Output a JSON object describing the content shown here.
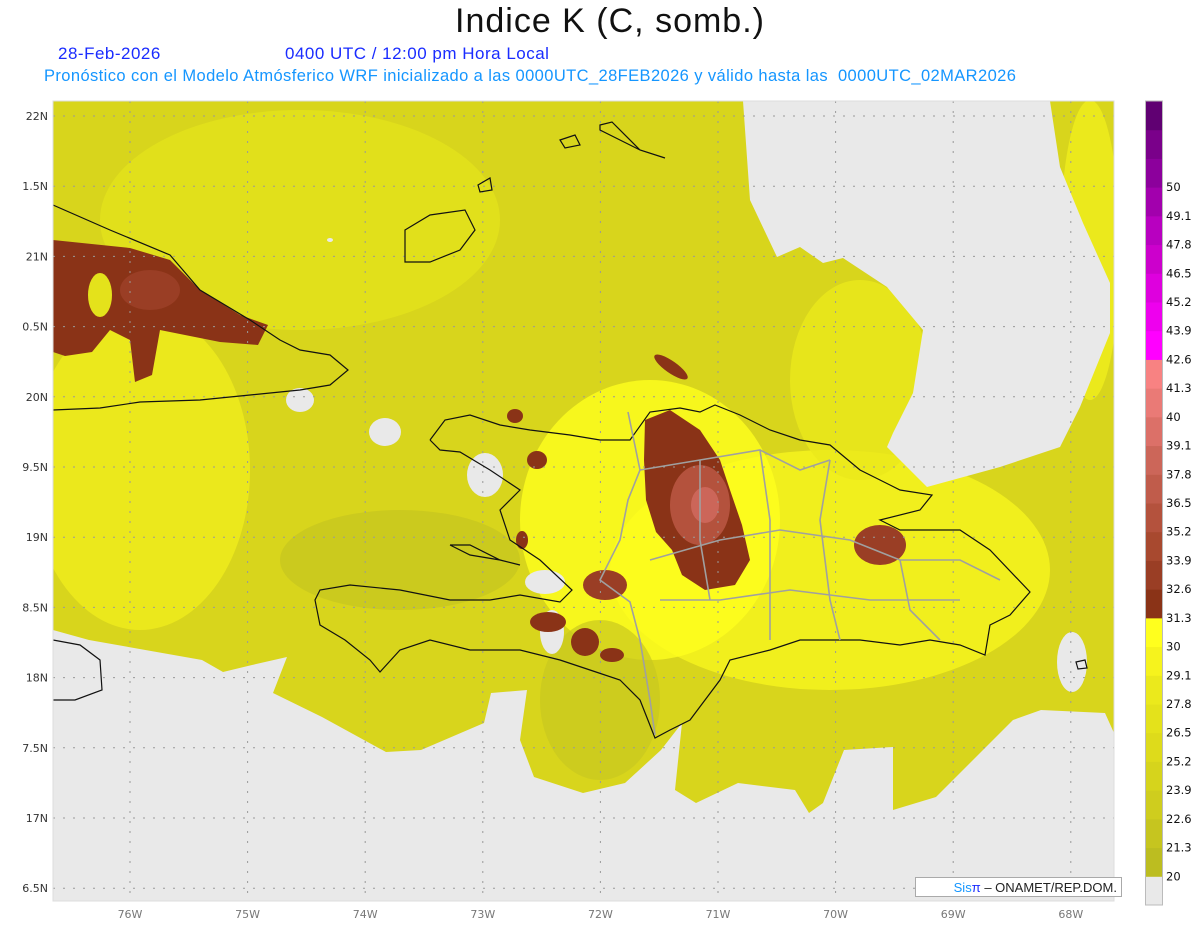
{
  "header": {
    "title": "Indice K (C, somb.)",
    "date": "28-Feb-2026",
    "time": "0400 UTC / 12:00 pm Hora Local",
    "forecast_info": "Pronóstico con el Modelo Atmósferico WRF inicializado a las 0000UTC_28FEB2026 y válido hasta las  0000UTC_02MAR2026"
  },
  "map": {
    "lat_labels": [
      "22N",
      "1.5N",
      "21N",
      "0.5N",
      "20N",
      "9.5N",
      "19N",
      "8.5N",
      "18N",
      "7.5N",
      "17N",
      "6.5N"
    ],
    "lon_labels": [
      "76W",
      "75W",
      "74W",
      "73W",
      "72W",
      "71W",
      "70W",
      "69W",
      "68W"
    ],
    "ocean_missing_color": "#e9e9e9",
    "coastline_color": "#111111",
    "province_border_color": "#a0a0a0"
  },
  "colorbar": {
    "labels": [
      "20",
      "21.3",
      "22.6",
      "23.9",
      "25.2",
      "26.5",
      "27.8",
      "29.1",
      "30",
      "31.3",
      "32.6",
      "33.9",
      "35.2",
      "36.5",
      "37.8",
      "39.1",
      "40",
      "41.3",
      "42.6",
      "43.9",
      "45.2",
      "46.5",
      "47.8",
      "49.1",
      "50"
    ],
    "colors": [
      "#e9e9e9",
      "#bcbd20",
      "#c6c51f",
      "#cfcd1e",
      "#d6d41c",
      "#dedb1b",
      "#e4e21b",
      "#ebe91c",
      "#f6f31d",
      "#ffff1e",
      "#8a3317",
      "#9a3e25",
      "#a8492f",
      "#b4523d",
      "#c05c4b",
      "#cc6659",
      "#dc7068",
      "#ea7a76",
      "#f88282",
      "#ff00ff",
      "#ee00ee",
      "#de00de",
      "#cc00cc",
      "#b800c0",
      "#a200ad",
      "#8c009c",
      "#7a008a",
      "#600072"
    ]
  },
  "credit": {
    "brand_sis": "Sis",
    "brand_pi": "π",
    "org": "– ONAMET/REP.DOM."
  }
}
